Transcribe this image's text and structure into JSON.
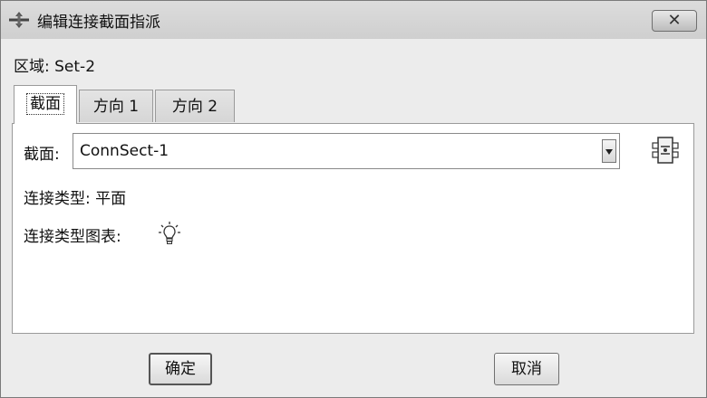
{
  "window": {
    "title": "编辑连接截面指派",
    "close_symbol": "✕",
    "app_icon": "abaqus-cross-icon"
  },
  "region": {
    "label": "区域:",
    "value": "Set-2"
  },
  "tabs": [
    {
      "label": "截面",
      "active": true
    },
    {
      "label": "方向 1",
      "active": false
    },
    {
      "label": "方向 2",
      "active": false
    }
  ],
  "section": {
    "label": "截面:",
    "selected": "ConnSect-1",
    "edit_icon": "edit-section-icon"
  },
  "connection_type": {
    "label": "连接类型:",
    "value": "平面"
  },
  "connection_chart": {
    "label": "连接类型图表:",
    "icon": "lightbulb-icon"
  },
  "buttons": {
    "ok": "确定",
    "cancel": "取消"
  }
}
